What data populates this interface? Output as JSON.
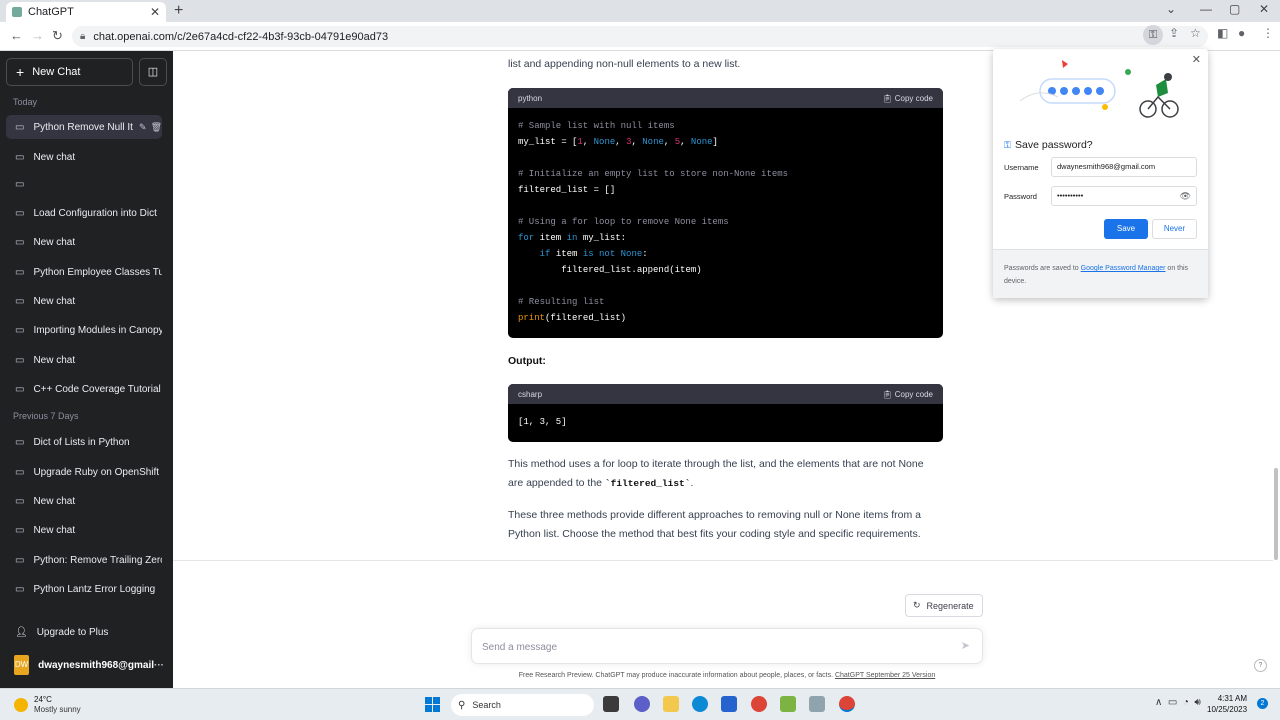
{
  "browser": {
    "tab_title": "ChatGPT",
    "tab_close": "✕",
    "new_tab": "+",
    "url": "chat.openai.com/c/2e67a4cd-cf22-4b3f-93cb-04791e90ad73"
  },
  "sidebar": {
    "new_chat_label": "New Chat",
    "section_today": "Today",
    "section_prev": "Previous 7 Days",
    "today_items": [
      "Python Remove Null It",
      "New chat",
      "",
      "Load Configuration into Dict",
      "New chat",
      "Python Employee Classes Tu",
      "New chat",
      "Importing Modules in Canopy",
      "New chat",
      "C++ Code Coverage Tutorial"
    ],
    "prev_items": [
      "Dict of Lists in Python",
      "Upgrade Ruby on OpenShift",
      "New chat",
      "New chat",
      "Python: Remove Trailing Zero",
      "Python Lantz Error Logging"
    ],
    "upgrade_label": "Upgrade to Plus",
    "avatar_initials": "DW",
    "user_email": "dwaynesmith968@gmail",
    "more": "···"
  },
  "main": {
    "intro_text": "list and appending non-null elements to a new list.",
    "code1": {
      "lang": "python",
      "copy_label": "Copy code",
      "lines": {
        "c1": "# Sample list with null items",
        "l2a": "my_list = [",
        "n1": "1",
        "none1": "None",
        "n3": "3",
        "none2": "None",
        "n5": "5",
        "none3": "None",
        "c2": "# Initialize an empty list to store non-None items",
        "l4": "filtered_list = []",
        "c3": "# Using a for loop to remove None items",
        "kw_for": "for",
        "l6a": " item ",
        "kw_in": "in",
        "l6b": " my_list:",
        "kw_if": "if",
        "l7a": " item ",
        "kw_isnot": "is not",
        "kw_none": "None",
        "l8": "filtered_list.append(item)",
        "c4": "# Resulting list",
        "fn_print": "print",
        "l10": "(filtered_list)"
      }
    },
    "output_label": "Output:",
    "code2": {
      "lang": "csharp",
      "copy_label": "Copy code",
      "line": "[1, 3, 5]"
    },
    "para1_a": "This method uses a for loop to iterate through the list, and the elements that are not None are appended to the ",
    "para1_code": "`filtered_list`",
    "para1_b": ".",
    "para2": "These three methods provide different approaches to removing null or None items from a Python list. Choose the method that best fits your coding style and specific requirements.",
    "regenerate_label": "Regenerate",
    "message_placeholder": "Send a message",
    "footer_text": "Free Research Preview. ChatGPT may produce inaccurate information about people, places, or facts. ",
    "footer_link": "ChatGPT September 25 Version",
    "help": "?"
  },
  "password_popup": {
    "title": "Save password?",
    "username_label": "Username",
    "username_value": "dwaynesmith968@gmail.com",
    "password_label": "Password",
    "password_value": "••••••••••",
    "save_label": "Save",
    "never_label": "Never",
    "note_a": "Passwords are saved to ",
    "note_link": "Google Password Manager",
    "note_b": " on this device."
  },
  "taskbar": {
    "temperature": "24°C",
    "weather": "Mostly sunny",
    "search_label": "Search",
    "time": "4:31 AM",
    "date": "10/25/2023",
    "notification_count": "2"
  },
  "colors": {
    "sidebar_bg": "#202123",
    "accent_blue": "#1a73e8",
    "code_bg": "#000000"
  }
}
